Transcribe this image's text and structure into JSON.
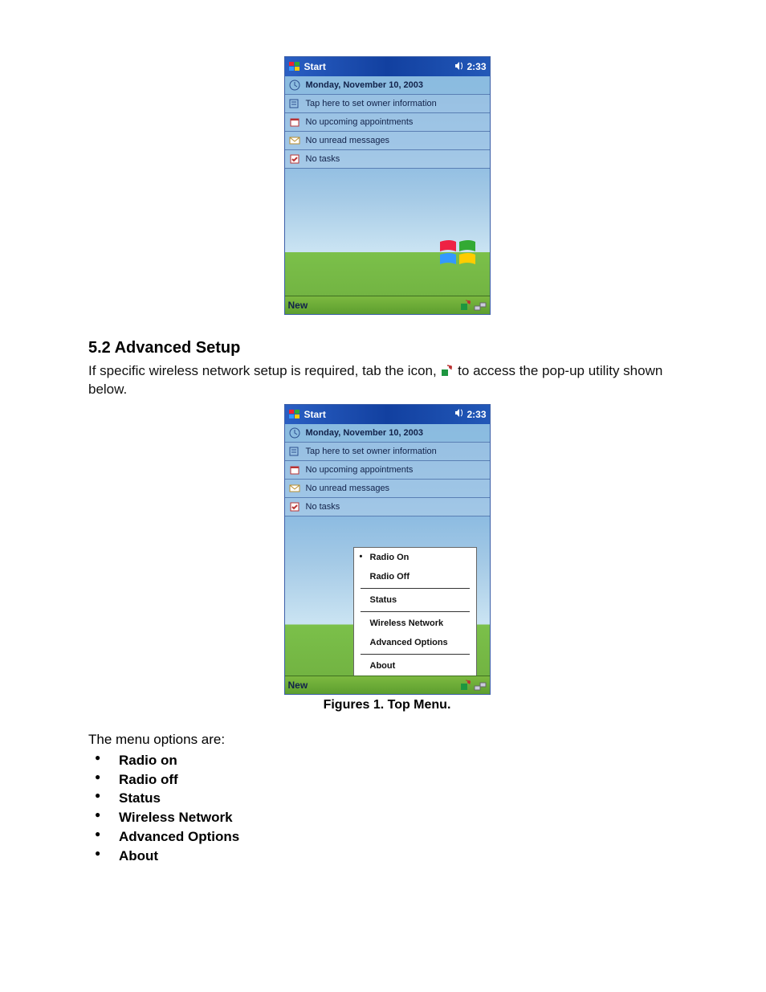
{
  "device": {
    "titlebar": {
      "start": "Start",
      "time": "2:33"
    },
    "today": {
      "date": "Monday, November 10, 2003",
      "owner": "Tap here to set owner information",
      "appointments": "No upcoming appointments",
      "messages": "No unread messages",
      "tasks": "No tasks"
    },
    "bottombar": {
      "new": "New"
    },
    "popup": {
      "radio_on": "Radio On",
      "radio_off": "Radio Off",
      "status": "Status",
      "wireless": "Wireless Network",
      "advanced": "Advanced Options",
      "about": "About"
    }
  },
  "doc": {
    "heading": "5.2 Advanced Setup",
    "para_pre": "If specific wireless network setup is required, tab the icon,",
    "para_post": " to access the pop-up utility shown below.",
    "caption": "Figures 1. Top Menu.",
    "list_lead": "The menu options are:",
    "bullets": {
      "b1": "Radio on",
      "b2": "Radio off",
      "b3": "Status",
      "b4": "Wireless Network",
      "b5": "Advanced Options",
      "b6": "About"
    }
  }
}
